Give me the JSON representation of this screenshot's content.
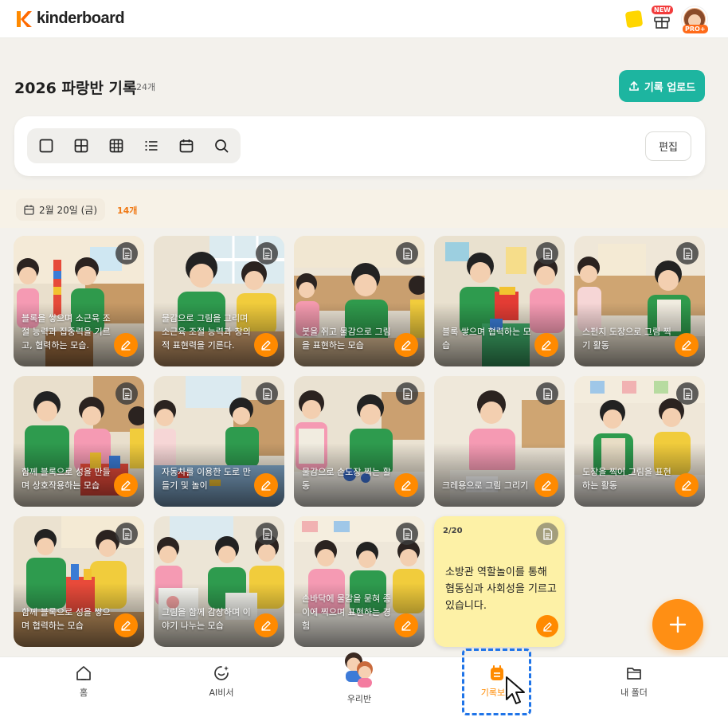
{
  "app": {
    "name": "kinderboard",
    "new_badge": "NEW",
    "pro_badge": "PRO+"
  },
  "page": {
    "title": "2026 파랑반 기록",
    "count": "24개",
    "upload_label": "기록 업로드",
    "edit_label": "편집"
  },
  "toolbar": {
    "views": [
      "single-view-icon",
      "grid-2-icon",
      "grid-3-icon",
      "list-icon",
      "calendar-icon",
      "search-icon"
    ]
  },
  "date_group": {
    "label": "2월 20일 (금)",
    "count": "14개"
  },
  "cards": [
    {
      "caption": "블록을 쌓으며 소근육 조절 능력과 집중력을 기르고, 협력하는 모습."
    },
    {
      "caption": "물감으로 그림을 그리며 소근육 조절 능력과 창의적 표현력을 기른다."
    },
    {
      "caption": "붓을 쥐고 물감으로 그림을 표현하는 모습"
    },
    {
      "caption": "블록 쌓으며 협력하는 모습"
    },
    {
      "caption": "스펀지 도장으로 그림 찍기 활동"
    },
    {
      "caption": "함께 블록으로 성을 만들며 상호작용하는 모습"
    },
    {
      "caption": "자동차를 이용한 도로 만들기 및 놀이"
    },
    {
      "caption": "물감으로 손도장 찍는 활동"
    },
    {
      "caption": "크레용으로 그림 그리기"
    },
    {
      "caption": "도장을 찍어 그림을 표현하는 활동"
    },
    {
      "caption": "함께 블록으로 성을 쌓으며 협력하는 모습"
    },
    {
      "caption": "그림을 함께 감상하며 이야기 나누는 모습"
    },
    {
      "caption": "손바닥에 물감을 묻혀 종이에 찍으며 표현하는 경험"
    }
  ],
  "note": {
    "date": "2/20",
    "text": "소방관 역할놀이를 통해 협동심과 사회성을 기르고 있습니다."
  },
  "nav": [
    {
      "label": "홈",
      "icon": "home-icon"
    },
    {
      "label": "AI비서",
      "icon": "ai-assistant-icon"
    },
    {
      "label": "우리반",
      "icon": "our-class-icon"
    },
    {
      "label": "기록보드",
      "icon": "record-board-icon"
    },
    {
      "label": "내 폴더",
      "icon": "folder-icon"
    }
  ],
  "colors": {
    "accent": "#ff8a00",
    "teal": "#1db5a0",
    "note": "#fdf1a6"
  }
}
